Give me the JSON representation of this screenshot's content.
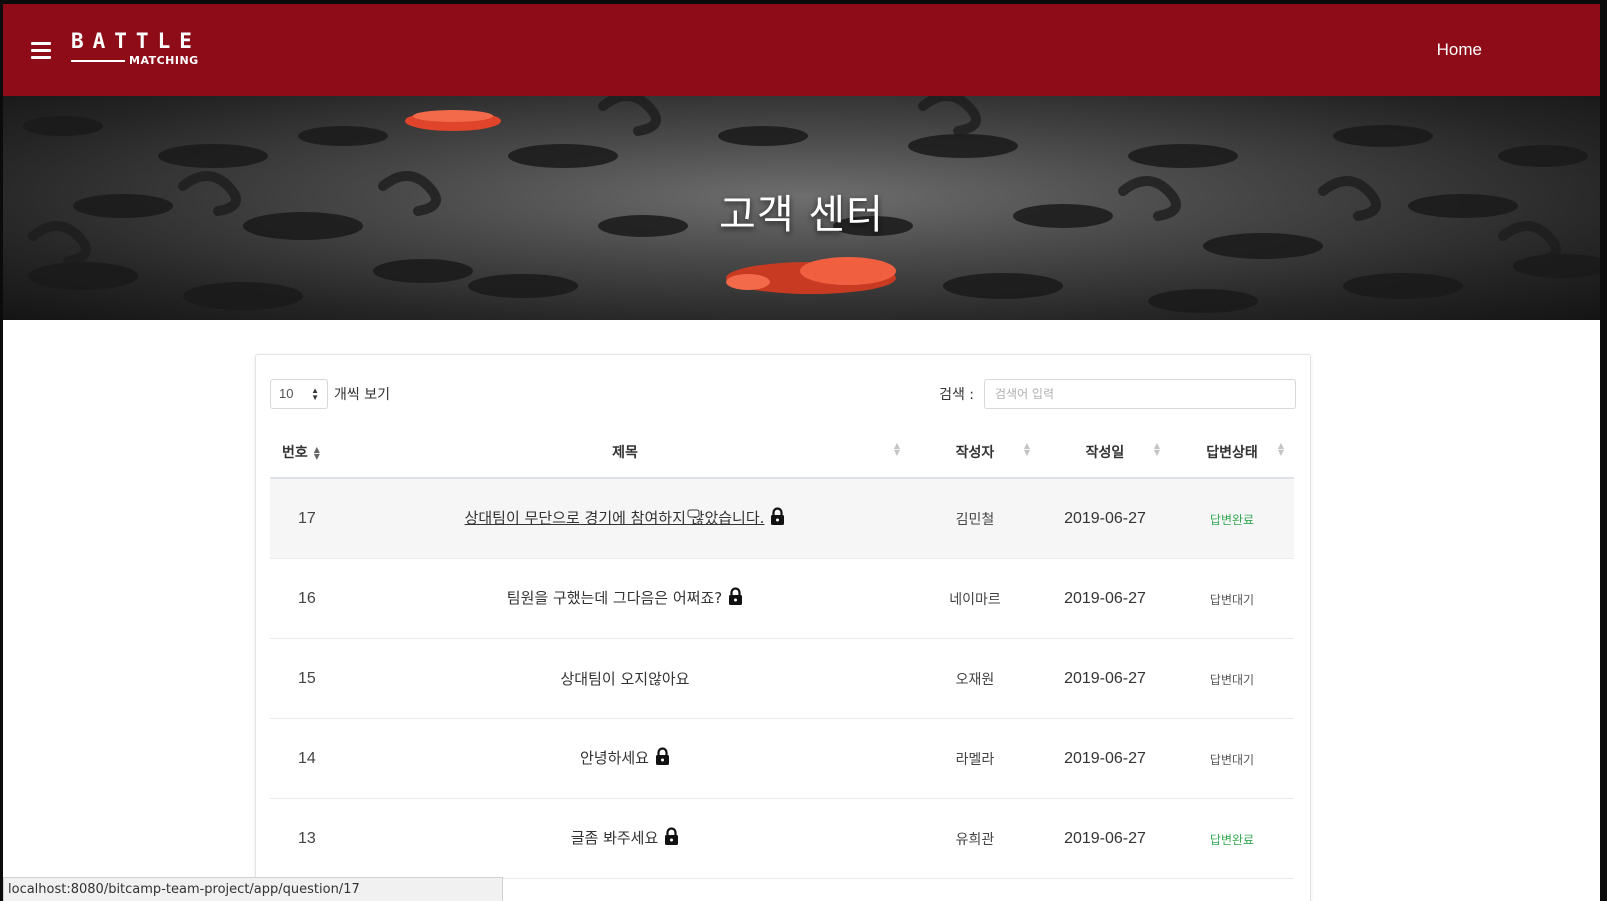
{
  "navbar": {
    "brand_top": "BATTLE",
    "brand_bottom": "MATCHING",
    "home_label": "Home",
    "bg_color": "#8e0c17"
  },
  "hero": {
    "title": "고객 센터"
  },
  "table_controls": {
    "length_value": "10",
    "length_suffix": "개씩 보기",
    "search_label": "검색 :",
    "search_placeholder": "검색어 입력"
  },
  "table": {
    "headers": [
      "번호",
      "제목",
      "작성자",
      "작성일",
      "답변상태"
    ],
    "rows": [
      {
        "num": "17",
        "title": "상대팀이 무단으로 경기에 참여하지 않았습니다.",
        "locked": true,
        "author": "김민철",
        "date": "2019-06-27",
        "status": "답변완료",
        "status_type": "done"
      },
      {
        "num": "16",
        "title": "팀원을 구했는데 그다음은 어쩌죠?",
        "locked": true,
        "author": "네이마르",
        "date": "2019-06-27",
        "status": "답변대기",
        "status_type": "wait"
      },
      {
        "num": "15",
        "title": "상대팀이 오지않아요",
        "locked": false,
        "author": "오재원",
        "date": "2019-06-27",
        "status": "답변대기",
        "status_type": "wait"
      },
      {
        "num": "14",
        "title": "안녕하세요",
        "locked": true,
        "author": "라멜라",
        "date": "2019-06-27",
        "status": "답변대기",
        "status_type": "wait"
      },
      {
        "num": "13",
        "title": "글좀 봐주세요",
        "locked": true,
        "author": "유희관",
        "date": "2019-06-27",
        "status": "답변완료",
        "status_type": "done"
      }
    ]
  },
  "status_bar": {
    "url": "localhost:8080/bitcamp-team-project/app/question/17"
  },
  "colors": {
    "done": "#34a853",
    "wait": "#555555"
  }
}
